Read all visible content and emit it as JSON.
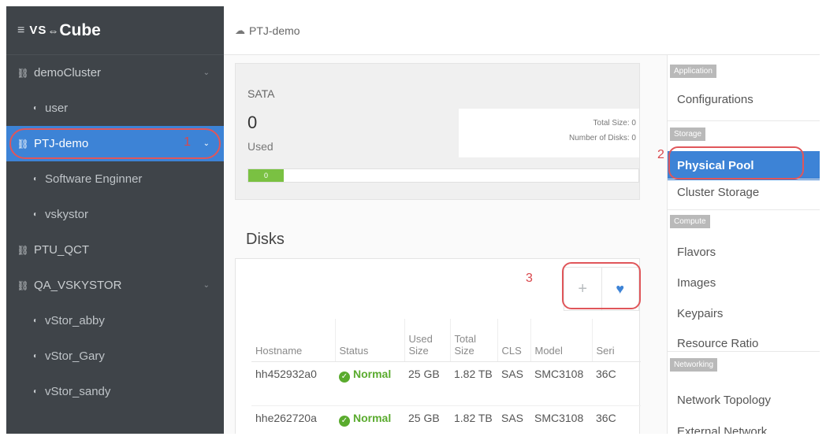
{
  "brand": {
    "menu_icon": "hamburger-icon",
    "logo_vs": "VS",
    "logo_link": "⇔",
    "logo_cube": "Cube"
  },
  "sidebar": {
    "items": [
      {
        "label": "demoCluster",
        "level": 0,
        "icon": "cluster-icon",
        "chevron": true,
        "active": false
      },
      {
        "label": "user",
        "level": 1,
        "icon": "project-icon",
        "chevron": false,
        "active": false
      },
      {
        "label": "PTJ-demo",
        "level": 0,
        "icon": "cluster-icon",
        "chevron": true,
        "active": true
      },
      {
        "label": "Software Enginner",
        "level": 1,
        "icon": "project-icon",
        "chevron": false,
        "active": false
      },
      {
        "label": "vskystor",
        "level": 1,
        "icon": "project-icon",
        "chevron": false,
        "active": false
      },
      {
        "label": "PTU_QCT",
        "level": 0,
        "icon": "cluster-icon",
        "chevron": false,
        "active": false
      },
      {
        "label": "QA_VSKYSTOR",
        "level": 0,
        "icon": "cluster-icon",
        "chevron": true,
        "active": false
      },
      {
        "label": "vStor_abby",
        "level": 1,
        "icon": "project-icon",
        "chevron": false,
        "active": false
      },
      {
        "label": "vStor_Gary",
        "level": 1,
        "icon": "project-icon",
        "chevron": false,
        "active": false
      },
      {
        "label": "vStor_sandy",
        "level": 1,
        "icon": "project-icon",
        "chevron": false,
        "active": false
      }
    ]
  },
  "header": {
    "title": "PTJ-demo",
    "icon": "cloud-icon"
  },
  "sata": {
    "title": "SATA",
    "used_value": "0",
    "used_label": "Used",
    "total_size": "Total Size: 0",
    "number_of_disks": "Number of Disks: 0",
    "progress_label": "0",
    "progress_fraction": 0
  },
  "disks": {
    "title": "Disks",
    "add_icon": "plus-icon",
    "health_icon": "heartbeat-icon",
    "columns": [
      "Hostname",
      "Status",
      "Used Size",
      "Total Size",
      "CLS",
      "Model",
      "Seri"
    ],
    "rows": [
      {
        "hostname": "hh452932a0",
        "status": "Normal",
        "used": "25 GB",
        "total": "1.82 TB",
        "cls": "SAS",
        "model": "SMC3108",
        "serial": "36C"
      },
      {
        "hostname": "hhe262720a",
        "status": "Normal",
        "used": "25 GB",
        "total": "1.82 TB",
        "cls": "SAS",
        "model": "SMC3108",
        "serial": "36C"
      }
    ]
  },
  "right_menu": {
    "sections": [
      {
        "label": "Application",
        "items": [
          {
            "label": "Configurations",
            "active": false
          }
        ]
      },
      {
        "label": "Storage",
        "items": [
          {
            "label": "Physical Pool",
            "active": true
          },
          {
            "label": "Cluster Storage",
            "active": false
          }
        ]
      },
      {
        "label": "Compute",
        "items": [
          {
            "label": "Flavors",
            "active": false
          },
          {
            "label": "Images",
            "active": false
          },
          {
            "label": "Keypairs",
            "active": false
          },
          {
            "label": "Resource Ratio",
            "active": false
          }
        ]
      },
      {
        "label": "Networking",
        "items": [
          {
            "label": "Network Topology",
            "active": false
          },
          {
            "label": "External Network",
            "active": false
          }
        ]
      }
    ]
  },
  "annotations": {
    "n1": "1",
    "n2": "2",
    "n3": "3",
    "color": "#e0565a"
  },
  "colors": {
    "sidebar_bg": "#3f4449",
    "accent": "#3d83d6",
    "ok": "#5aab2e",
    "progress": "#7ac142"
  }
}
